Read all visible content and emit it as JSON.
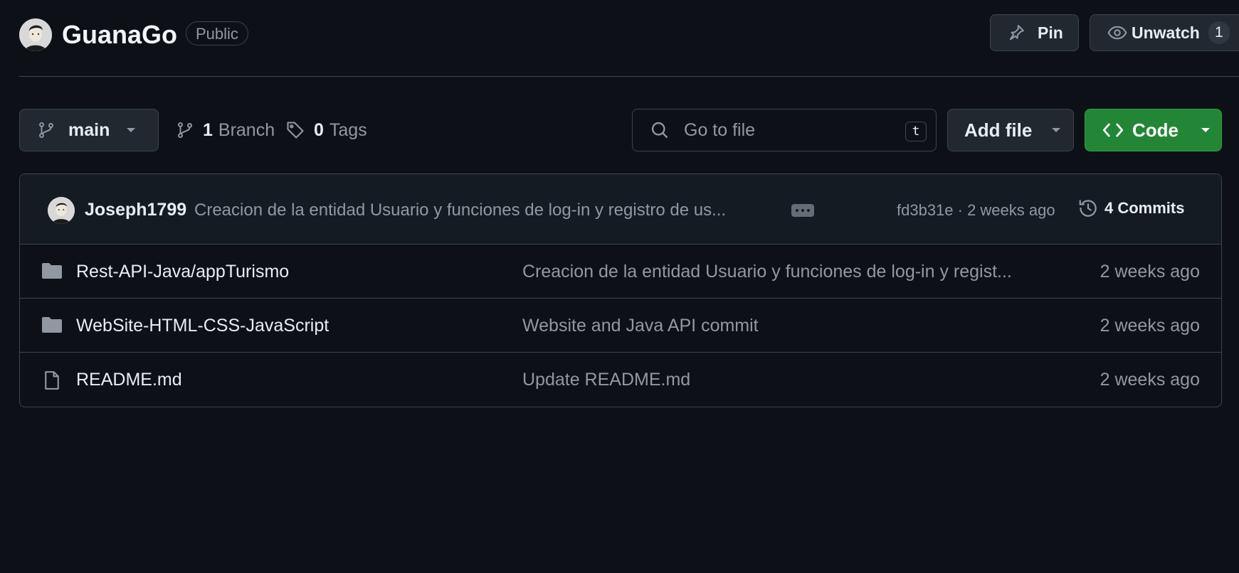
{
  "repo": {
    "name": "GuanaGo",
    "visibility": "Public",
    "owner_avatar": "avatar"
  },
  "header_actions": {
    "pin_label": "Pin",
    "unwatch_label": "Unwatch",
    "watch_count": "1"
  },
  "toolbar": {
    "branch_name": "main",
    "branch_count": "1",
    "branch_label": "Branch",
    "tag_count": "0",
    "tag_label": "Tags",
    "search_placeholder": "Go to file",
    "search_shortcut": "t",
    "add_file_label": "Add file",
    "code_label": "Code"
  },
  "latest_commit": {
    "author": "Joseph1799",
    "message": "Creacion de la entidad Usuario y funciones de log-in y registro de us...",
    "sha_time": "fd3b31e · 2 weeks ago",
    "commits_label": "4 Commits"
  },
  "files": [
    {
      "type": "folder",
      "icon": "folder-icon",
      "name": "Rest-API-Java/appTurismo",
      "message": "Creacion de la entidad Usuario y funciones de log-in y regist...",
      "time": "2 weeks ago"
    },
    {
      "type": "folder",
      "icon": "folder-icon",
      "name": "WebSite-HTML-CSS-JavaScript",
      "message": "Website and Java API commit",
      "time": "2 weeks ago"
    },
    {
      "type": "file",
      "icon": "file-icon",
      "name": "README.md",
      "message": "Update README.md",
      "time": "2 weeks ago"
    }
  ],
  "colors": {
    "background": "#0d1117",
    "border": "#3d444d",
    "muted_text": "#9198a1",
    "code_button": "#238636"
  }
}
